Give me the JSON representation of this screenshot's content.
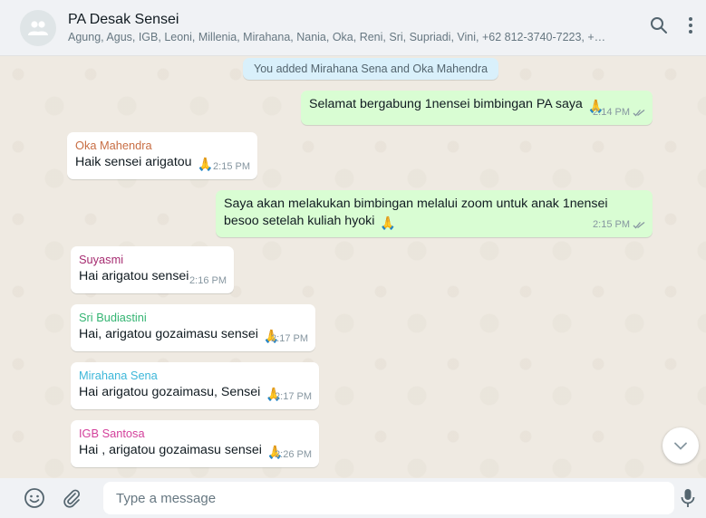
{
  "header": {
    "chat_name": "PA Desak Sensei",
    "members": "Agung, Agus, IGB, Leoni, Millenia, Mirahana, Nania, Oka, Reni, Sri, Supriadi, Vini, +62 812-3740-7223, +62 812-...",
    "icons": [
      "group-avatar-icon",
      "search-icon",
      "menu-icon"
    ]
  },
  "system_message": "You added Mirahana Sena and Oka Mahendra",
  "messages": [
    {
      "direction": "out",
      "sender": "",
      "text": "Selamat bergabung 1nensei bimbingan PA saya",
      "emoji": "🙏",
      "time": "2:14 PM",
      "status": "read"
    },
    {
      "direction": "in",
      "sender": "Oka Mahendra",
      "sender_color": "#c86e44",
      "text": "Haik sensei arigatou",
      "emoji": "🙏",
      "time": "2:15 PM"
    },
    {
      "direction": "out",
      "sender": "",
      "text": "Saya akan melakukan bimbingan melalui zoom untuk anak 1nensei besoo setelah kuliah hyoki",
      "emoji": "🙏",
      "time": "2:15 PM",
      "status": "read"
    },
    {
      "direction": "in",
      "sender": "Suyasmi",
      "sender_color": "#a62c71",
      "text": "Hai arigatou sensei",
      "emoji": "",
      "time": "2:16 PM"
    },
    {
      "direction": "in",
      "sender": "Sri Budiastini",
      "sender_color": "#35b573",
      "text": "Hai, arigatou gozaimasu sensei",
      "emoji": "🙏",
      "time": "2:17 PM"
    },
    {
      "direction": "in",
      "sender": "Mirahana Sena",
      "sender_color": "#3db7d9",
      "text": "Hai arigatou gozaimasu, Sensei",
      "emoji": "🙏",
      "time": "2:17 PM"
    },
    {
      "direction": "in",
      "sender": "IGB Santosa",
      "sender_color": "#d33f9b",
      "text": "Hai , arigatou gozaimasu sensei",
      "emoji": "🙏",
      "time": "2:26 PM"
    }
  ],
  "composer": {
    "placeholder": "Type a message",
    "icons": [
      "emoji-icon",
      "attach-icon",
      "mic-icon"
    ]
  },
  "colors": {
    "outgoing_bubble": "#d9fdd3",
    "incoming_bubble": "#ffffff",
    "read_tick": "#8696a0",
    "header_bg": "#f0f2f5"
  }
}
